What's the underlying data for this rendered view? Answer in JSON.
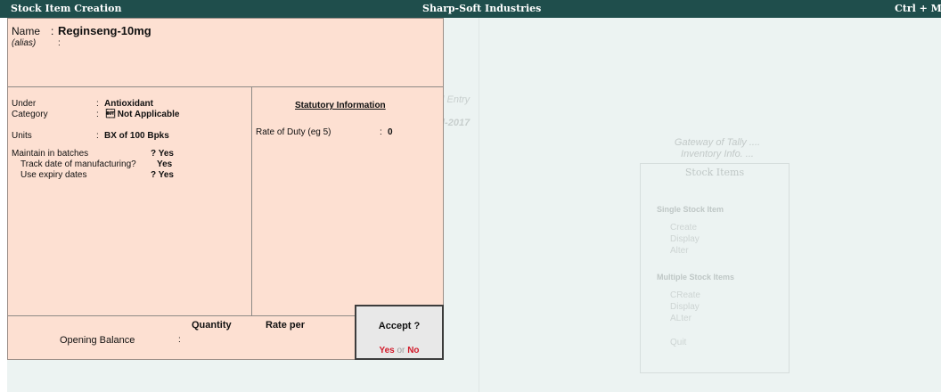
{
  "titlebar": {
    "left": "Stock Item Creation",
    "center": "Sharp-Soft Industries",
    "right": "Ctrl + M"
  },
  "background": {
    "entry_fragment": "l Entry",
    "date_fragment": "l-2017",
    "gateway": "Gateway of Tally ....",
    "inventory_info": "Inventory Info. ...",
    "menu_title": "Stock Items",
    "single_section": "Single Stock Item",
    "single_options": [
      "Create",
      "Display",
      "Alter"
    ],
    "multiple_section": "Multiple Stock Items",
    "multiple_options": [
      "CReate",
      "Display",
      "ALter"
    ],
    "quit": "Quit"
  },
  "form": {
    "name_label": "Name",
    "name_value": "Reginseng-10mg",
    "alias_label": "(alias)",
    "under_label": "Under",
    "under_value": "Antioxidant",
    "category_label": "Category",
    "category_value": "\u0004 Not Applicable",
    "units_label": "Units",
    "units_value": "BX of 100 Bpks",
    "batches_label": "Maintain in batches",
    "batches_value": "? Yes",
    "track_label": "Track date of manufacturing?",
    "track_value": "Yes",
    "expiry_label": "Use expiry dates",
    "expiry_value": "? Yes",
    "statutory_title": "Statutory Information",
    "duty_label": "Rate of Duty (eg 5)",
    "duty_value": "0",
    "quantity_header": "Quantity",
    "rate_header": "Rate per",
    "opening_label": "Opening Balance"
  },
  "accept": {
    "question": "Accept ?",
    "yes": "Yes",
    "or": "or",
    "no": "No"
  }
}
